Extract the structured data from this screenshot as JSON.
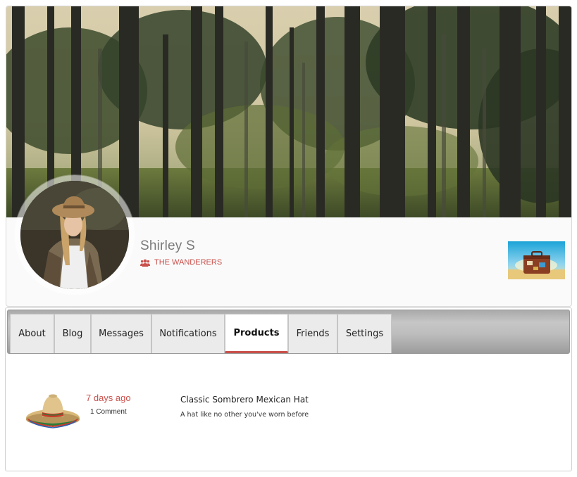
{
  "profile": {
    "name": "Shirley S",
    "group_label": "THE WANDERERS",
    "cover_icon": "forest-cover-image",
    "avatar_icon": "user-avatar-photo",
    "group_icon": "users-icon",
    "group_thumb_icon": "suitcase-thumbnail"
  },
  "colors": {
    "accent": "#c9504b",
    "name_text": "#7a7a7a",
    "tab_bg": "#ebebeb",
    "tab_active_bg": "#ffffff"
  },
  "tabs": [
    {
      "label": "About",
      "active": false
    },
    {
      "label": "Blog",
      "active": false
    },
    {
      "label": "Messages",
      "active": false
    },
    {
      "label": "Notifications",
      "active": false
    },
    {
      "label": "Products",
      "active": true
    },
    {
      "label": "Friends",
      "active": false
    },
    {
      "label": "Settings",
      "active": false
    }
  ],
  "products": [
    {
      "age": "7 days ago",
      "comments": "1 Comment",
      "title": "Classic Sombrero Mexican Hat",
      "description": "A hat like no other you've worn before",
      "icon": "sombrero-image"
    }
  ]
}
